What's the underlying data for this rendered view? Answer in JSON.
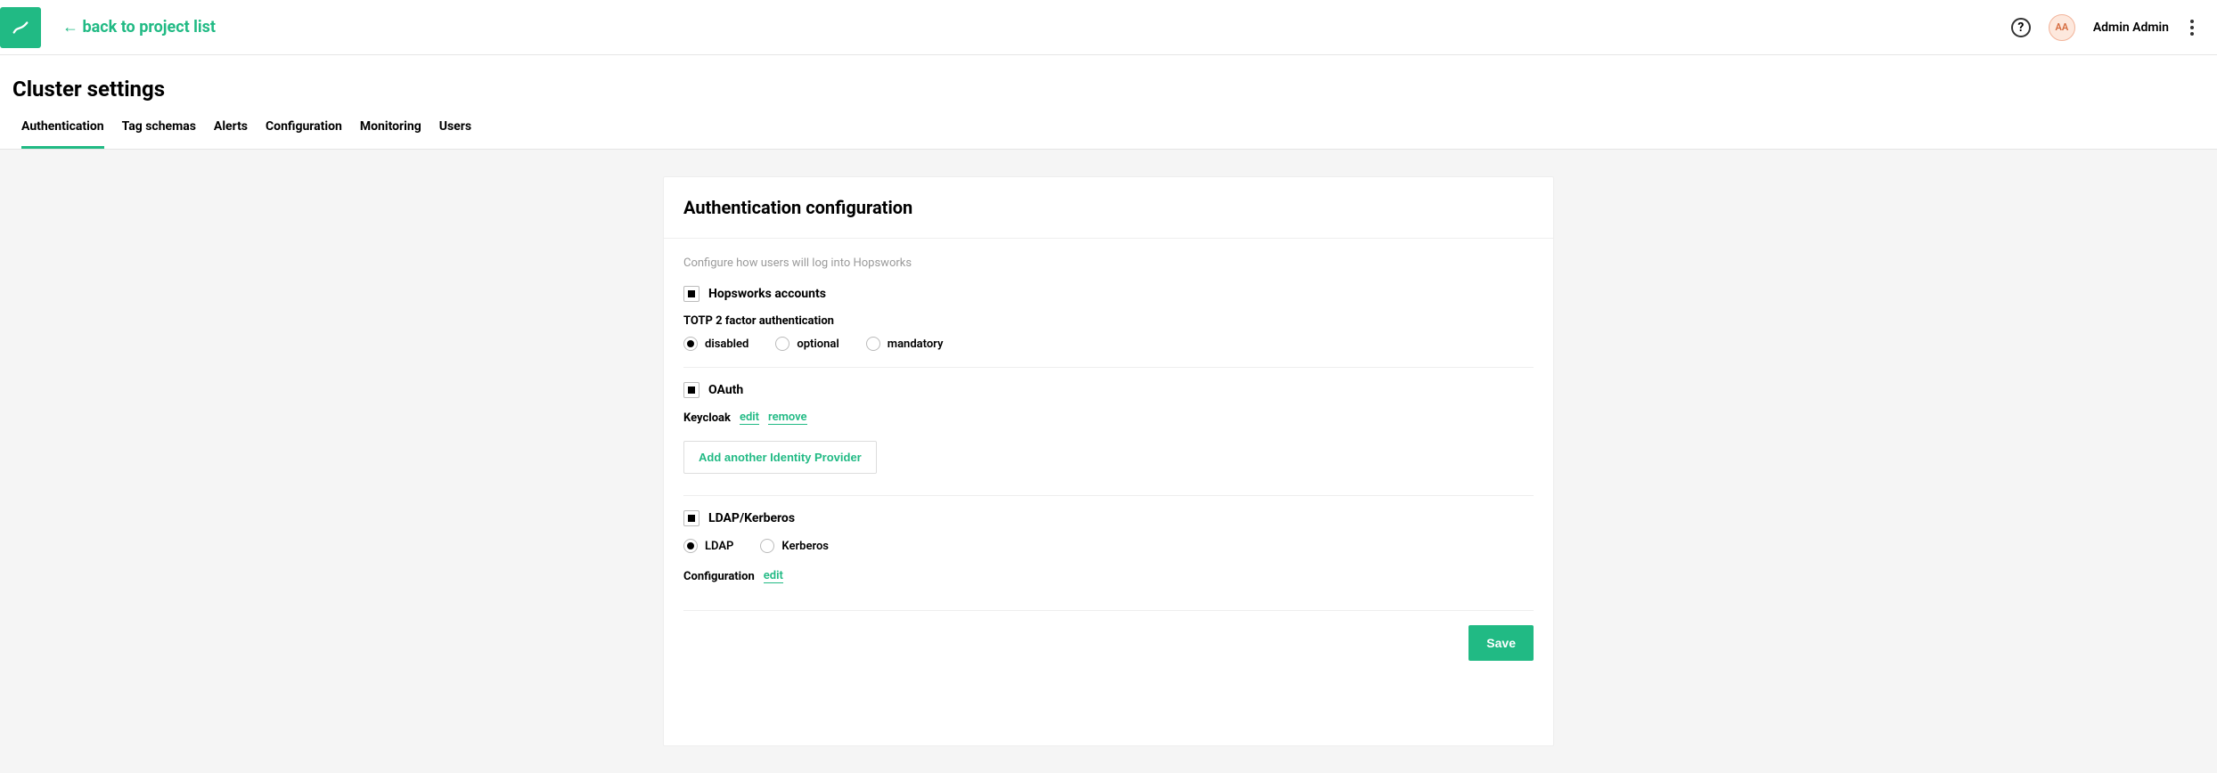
{
  "header": {
    "back_link": "← back to project list",
    "user_initials": "AA",
    "user_name": "Admin Admin"
  },
  "page": {
    "title": "Cluster settings"
  },
  "tabs": [
    {
      "label": "Authentication",
      "active": true
    },
    {
      "label": "Tag schemas",
      "active": false
    },
    {
      "label": "Alerts",
      "active": false
    },
    {
      "label": "Configuration",
      "active": false
    },
    {
      "label": "Monitoring",
      "active": false
    },
    {
      "label": "Users",
      "active": false
    }
  ],
  "card": {
    "title": "Authentication configuration",
    "hint": "Configure how users will log into Hopsworks",
    "hopsworks": {
      "label": "Hopsworks accounts",
      "totp_label": "TOTP 2 factor authentication",
      "options": [
        {
          "label": "disabled",
          "selected": true
        },
        {
          "label": "optional",
          "selected": false
        },
        {
          "label": "mandatory",
          "selected": false
        }
      ]
    },
    "oauth": {
      "label": "OAuth",
      "provider": "Keycloak",
      "edit": "edit",
      "remove": "remove",
      "add_btn": "Add another Identity Provider"
    },
    "ldap": {
      "label": "LDAP/Kerberos",
      "options": [
        {
          "label": "LDAP",
          "selected": true
        },
        {
          "label": "Kerberos",
          "selected": false
        }
      ],
      "config_label": "Configuration",
      "edit": "edit"
    },
    "save": "Save"
  }
}
